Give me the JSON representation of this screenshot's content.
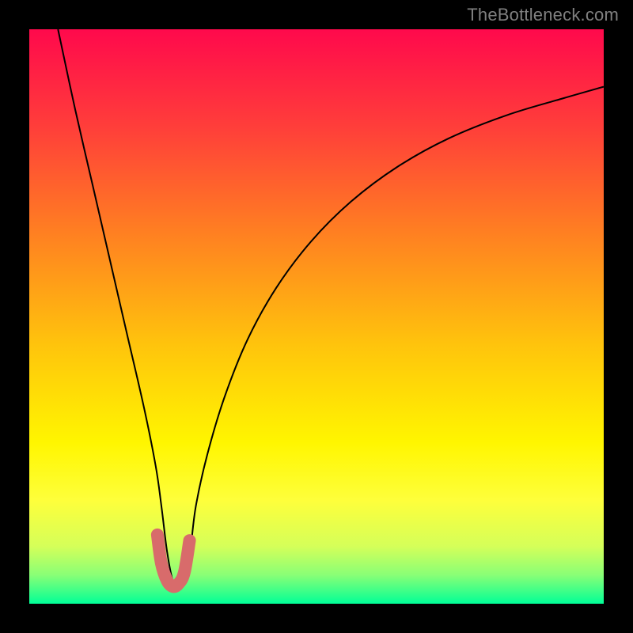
{
  "watermark": "TheBottleneck.com",
  "chart_data": {
    "type": "line",
    "title": "",
    "xlabel": "",
    "ylabel": "",
    "xlim": [
      0,
      100
    ],
    "ylim": [
      0,
      100
    ],
    "curve_description": "V-shaped bottleneck curve with minimum near x≈25. Left branch steeply descends from top-left, right branch ascends with decreasing slope toward the right. Background is a vertical gradient from red (top) through orange, yellow, to green (bottom).",
    "gradient_stops": [
      {
        "offset": 0,
        "color": "#ff094c"
      },
      {
        "offset": 17,
        "color": "#ff3e3a"
      },
      {
        "offset": 35,
        "color": "#ff7e22"
      },
      {
        "offset": 55,
        "color": "#ffc40c"
      },
      {
        "offset": 72,
        "color": "#fff600"
      },
      {
        "offset": 82,
        "color": "#feff3b"
      },
      {
        "offset": 90,
        "color": "#d5ff59"
      },
      {
        "offset": 95,
        "color": "#89ff76"
      },
      {
        "offset": 99,
        "color": "#1dff90"
      },
      {
        "offset": 100,
        "color": "#00ff99"
      }
    ],
    "series": [
      {
        "name": "bottleneck-curve",
        "x": [
          5,
          8,
          11,
          14,
          17,
          20,
          22,
          23,
          24,
          25,
          26,
          27,
          28,
          29,
          31,
          34,
          38,
          43,
          49,
          56,
          64,
          73,
          83,
          93,
          100
        ],
        "y": [
          100,
          86,
          73,
          60,
          47,
          34,
          24,
          17,
          9,
          4,
          3,
          4,
          9,
          17,
          26,
          36,
          46,
          55,
          63,
          70,
          76,
          81,
          85,
          88,
          90
        ]
      },
      {
        "name": "bottom-highlight",
        "x": [
          22.3,
          23,
          24,
          25,
          26,
          27,
          27.9
        ],
        "y": [
          12,
          7,
          4,
          3,
          3.5,
          5.5,
          11
        ],
        "color": "#d86b6b"
      }
    ]
  }
}
